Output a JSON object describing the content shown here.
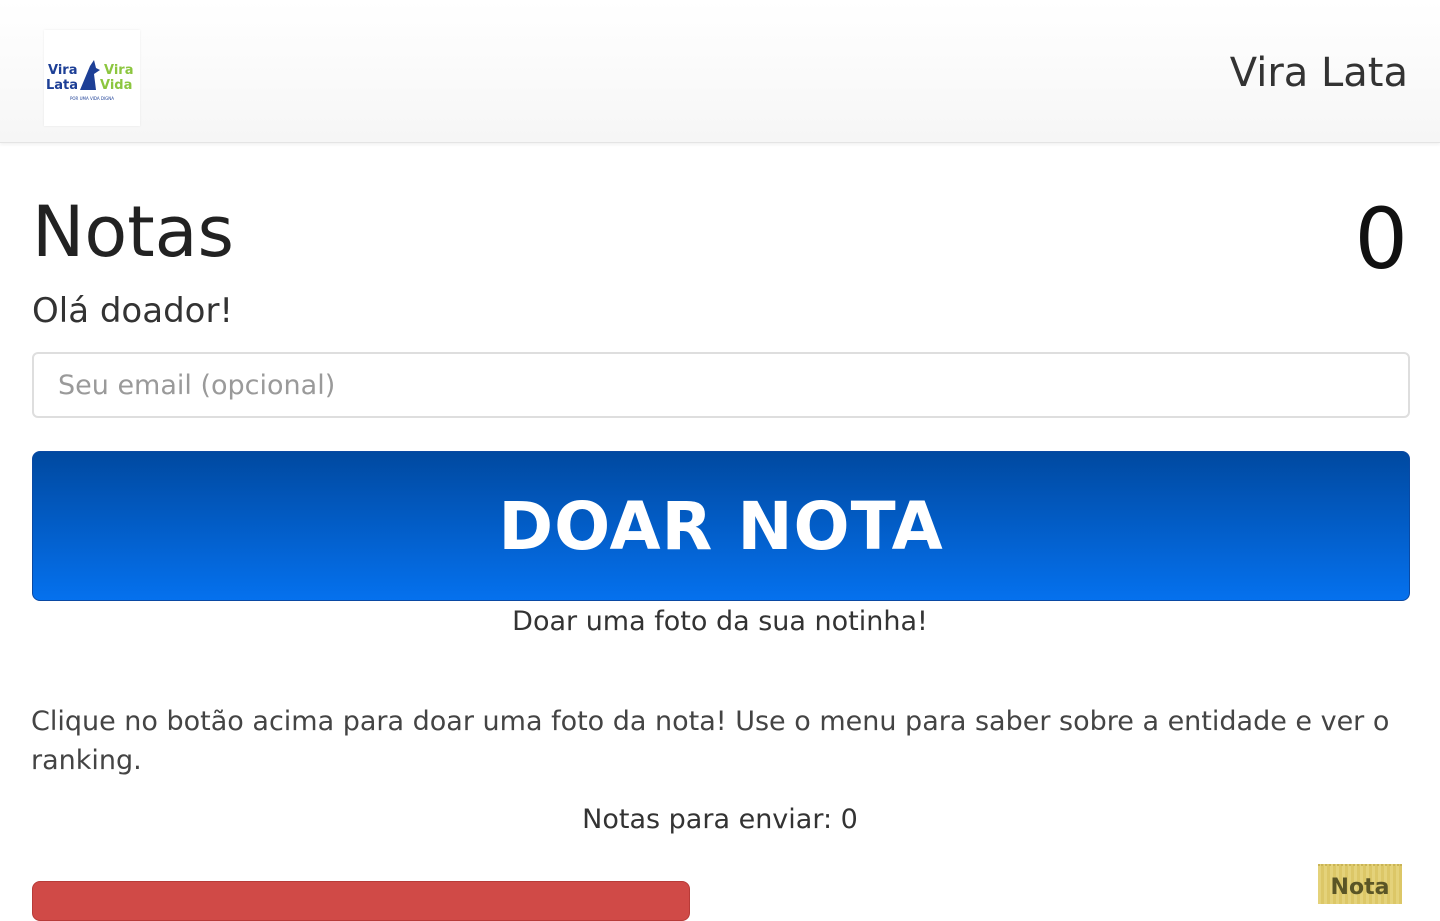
{
  "header": {
    "logo": {
      "line1_left": "Vira",
      "line2_left": "Lata",
      "line1_right": "Vira",
      "line2_right": "Vida",
      "tagline": "POR UMA VIDA DIGNA"
    },
    "title": "Vira Lata"
  },
  "main": {
    "title": "Notas",
    "counter": "0",
    "greeting": "Olá doador!",
    "email_placeholder": "Seu email (opcional)",
    "email_value": "",
    "donate_button_label": "DOAR NOTA",
    "donate_caption": "Doar uma foto da sua notinha!",
    "instructions": "Clique no botão acima para doar uma foto da nota! Use o menu para saber sobre a entidade e ver o ranking.",
    "pending": "Notas para enviar: 0"
  },
  "footer": {
    "nota_thumb_label": "Nota"
  },
  "colors": {
    "primary_button_top": "#0049a0",
    "primary_button_bottom": "#0571ee",
    "danger_button": "#d04a47",
    "logo_blue": "#1d3f96",
    "logo_green": "#8cc63f"
  }
}
